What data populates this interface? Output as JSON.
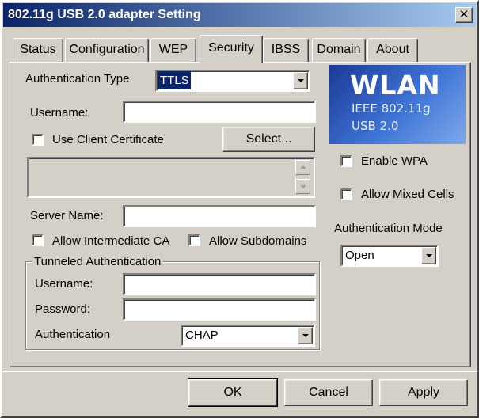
{
  "window": {
    "title": "802.11g USB 2.0 adapter Setting",
    "close_glyph": "✕"
  },
  "tabs": [
    {
      "label": "Status"
    },
    {
      "label": "Configuration"
    },
    {
      "label": "WEP"
    },
    {
      "label": "Security",
      "active": true
    },
    {
      "label": "IBSS"
    },
    {
      "label": "Domain"
    },
    {
      "label": "About"
    }
  ],
  "security": {
    "auth_type_label": "Authentication Type",
    "auth_type_value": "TTLS",
    "username_label": "Username:",
    "username_value": "",
    "use_client_cert_label": "Use Client Certificate",
    "use_client_cert_checked": false,
    "select_button": "Select...",
    "server_name_label": "Server Name:",
    "server_name_value": "",
    "allow_intermediate_ca_label": "Allow Intermediate CA",
    "allow_intermediate_ca_checked": false,
    "allow_subdomains_label": "Allow Subdomains",
    "allow_subdomains_checked": false,
    "tunneled": {
      "title": "Tunneled Authentication",
      "username_label": "Username:",
      "username_value": "",
      "password_label": "Password:",
      "password_value": "",
      "auth_label": "Authentication",
      "auth_value": "CHAP"
    },
    "enable_wpa_label": "Enable WPA",
    "enable_wpa_checked": false,
    "allow_mixed_cells_label": "Allow Mixed Cells",
    "allow_mixed_cells_checked": false,
    "auth_mode_label": "Authentication Mode",
    "auth_mode_value": "Open"
  },
  "logo": {
    "big": "WLAN",
    "line1": "IEEE 802.11g",
    "line2": "USB 2.0"
  },
  "buttons": {
    "ok": "OK",
    "cancel": "Cancel",
    "apply": "Apply"
  },
  "colors": {
    "titlebar_start": "#0a246a",
    "titlebar_end": "#a6caf0",
    "face": "#d4d0c8",
    "selection": "#0a246a"
  }
}
